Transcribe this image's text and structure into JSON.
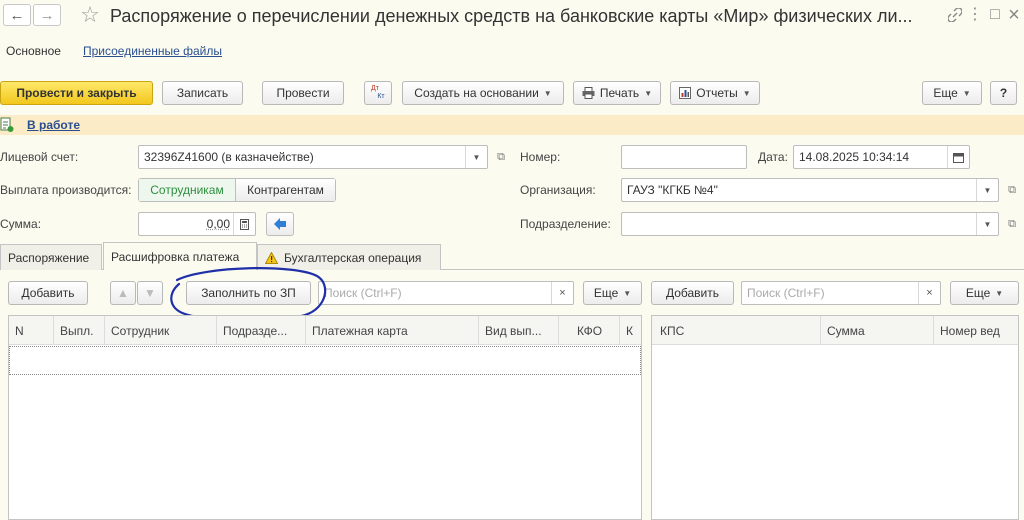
{
  "window": {
    "title": "Распоряжение о перечислении денежных средств на банковские карты «Мир» физических ли...",
    "back_icon": "←",
    "forward_icon": "→",
    "star_icon": "☆",
    "link_icon": "🔗",
    "more_icon": "⋮",
    "maximize_icon": "□",
    "close_icon": "×"
  },
  "sections": {
    "main": "Основное",
    "attached_files": "Присоединенные файлы"
  },
  "toolbar": {
    "post_and_close": "Провести и закрыть",
    "save": "Записать",
    "post": "Провести",
    "dtkt_top": "Дт",
    "dtkt_bottom": "Кт",
    "create_based_on": "Создать на основании",
    "print": "Печать",
    "reports": "Отчеты",
    "more": "Еще",
    "help": "?"
  },
  "status": {
    "text": "В работе"
  },
  "form": {
    "account_label": "Лицевой счет:",
    "account_value": "32396Z41600 (в казначействе)",
    "number_label": "Номер:",
    "number_value": "",
    "date_label": "Дата:",
    "date_value": "14.08.2025 10:34:14",
    "payment_to_label": "Выплата производится:",
    "payment_to_employees": "Сотрудникам",
    "payment_to_contractors": "Контрагентам",
    "organization_label": "Организация:",
    "organization_value": "ГАУЗ \"КГКБ №4\"",
    "amount_label": "Сумма:",
    "amount_value": "0,00",
    "department_label": "Подразделение:",
    "department_value": ""
  },
  "tabs": [
    {
      "label": "Распоряжение"
    },
    {
      "label": "Расшифровка платежа"
    },
    {
      "label": "Бухгалтерская операция"
    }
  ],
  "left_panel": {
    "add": "Добавить",
    "fill_by_zp": "Заполнить по ЗП",
    "search_placeholder": "Поиск (Ctrl+F)",
    "more": "Еще",
    "columns": [
      "N",
      "Выпл.",
      "Сотрудник",
      "Подразде...",
      "Платежная карта",
      "Вид вып...",
      "КФО",
      "К"
    ]
  },
  "right_panel": {
    "add": "Добавить",
    "search_placeholder": "Поиск (Ctrl+F)",
    "more": "Еще",
    "columns": [
      "КПС",
      "Сумма",
      "Номер вед"
    ]
  },
  "colors": {
    "background": "#fbfbf0",
    "primary_button": "#f2c71d",
    "link": "#2a4f8f",
    "status_bar": "#fbecc7",
    "annotation": "#1f2fa8",
    "active_toggle_text": "#2f8f3f"
  }
}
